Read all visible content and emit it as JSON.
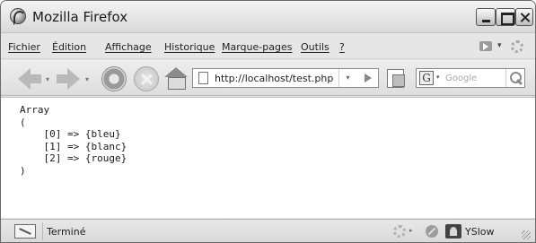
{
  "window": {
    "title": "Mozilla Firefox",
    "app_icon": "firefox-icon",
    "buttons": [
      "minimize-icon",
      "maximize-icon",
      "close-icon"
    ]
  },
  "menubar": {
    "items": [
      {
        "label": "Fichier"
      },
      {
        "label": "Édition"
      },
      {
        "label": "Affichage"
      },
      {
        "label": "Historique"
      },
      {
        "label": "Marque-pages"
      },
      {
        "label": "Outils"
      },
      {
        "label": "?"
      }
    ],
    "dropdown_glyph": "▾"
  },
  "navbar": {
    "dropdown_glyph": "▾",
    "url": "http://localhost/test.php",
    "url_dropdown_glyph": "▾",
    "search_engine_letter": "G",
    "search_engine_dropdown_glyph": "▾",
    "search_placeholder": "Google"
  },
  "content": {
    "text": "Array\n(\n    [0] => {bleu}\n    [1] => {blanc}\n    [2] => {rouge}\n)"
  },
  "statusbar": {
    "status": "Terminé",
    "dropdown_glyph": "▸",
    "yslow_label": "YSlow"
  },
  "colors": {
    "chrome_bg": "#e4e4e4",
    "content_bg": "#ffffff",
    "text": "#1a1a1a"
  }
}
